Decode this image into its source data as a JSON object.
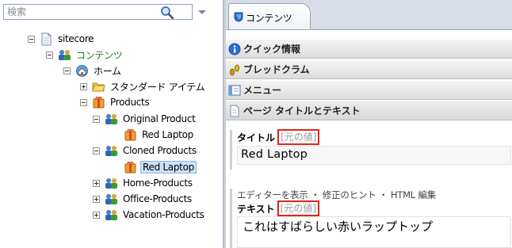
{
  "search": {
    "placeholder": "検索"
  },
  "tree": {
    "items": [
      {
        "label": "sitecore"
      },
      {
        "label": "コンテンツ"
      },
      {
        "label": "ホーム"
      },
      {
        "label": "スタンダード アイテム"
      },
      {
        "label": "Products"
      },
      {
        "label": "Original Product"
      },
      {
        "label": "Red Laptop"
      },
      {
        "label": "Cloned Products"
      },
      {
        "label": "Red Laptop"
      },
      {
        "label": "Home-Products"
      },
      {
        "label": "Office-Products"
      },
      {
        "label": "Vacation-Products"
      }
    ]
  },
  "editor": {
    "tab_label": "コンテンツ",
    "sections": [
      {
        "label": "クイック情報"
      },
      {
        "label": "ブレッドクラム"
      },
      {
        "label": "メニュー"
      },
      {
        "label": "ページ タイトルとテキスト"
      }
    ],
    "title_field": {
      "label": "タイトル",
      "original_link": "[元の値]",
      "value": "Red Laptop"
    },
    "editor_links": "エディターを表示 ・ 修正のヒント ・ HTML 編集",
    "text_field": {
      "label": "テキスト",
      "original_link": "[元の値]",
      "value": "これはすばらしい赤いラップトップ"
    }
  },
  "colors": {
    "highlight_box": "#e2231a",
    "selected_bg": "#cce2f6",
    "content_label": "#1c7a1c"
  }
}
